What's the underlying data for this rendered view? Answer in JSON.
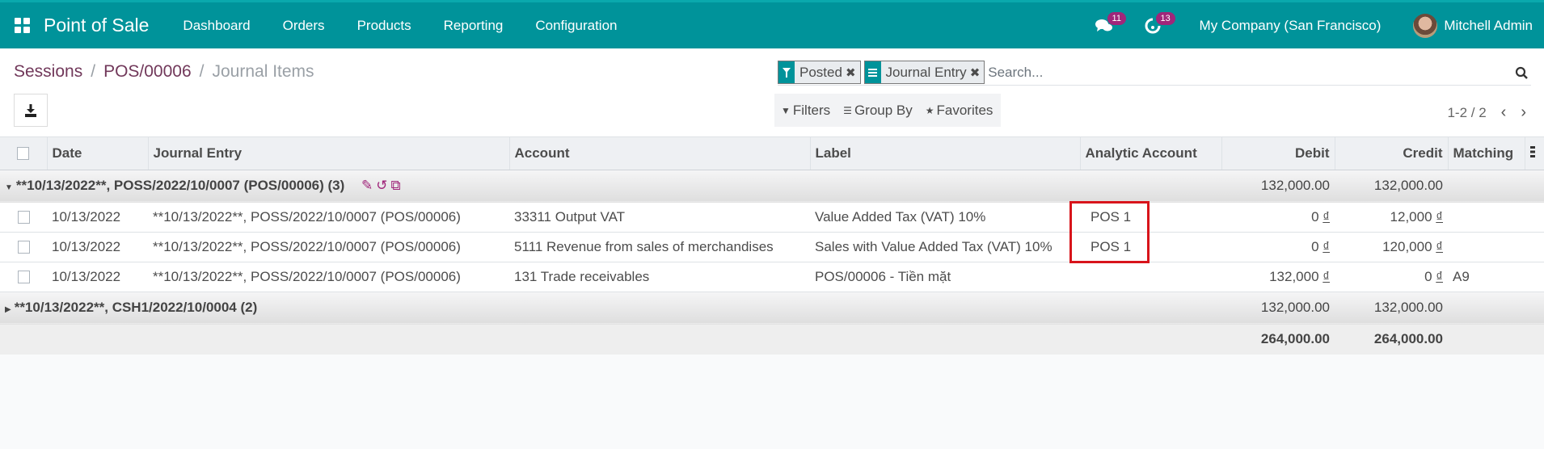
{
  "navbar": {
    "app_name": "Point of Sale",
    "menu": [
      "Dashboard",
      "Orders",
      "Products",
      "Reporting",
      "Configuration"
    ],
    "messages_count": "11",
    "activities_count": "13",
    "company": "My Company (San Francisco)",
    "user": "Mitchell Admin"
  },
  "breadcrumb": {
    "items": [
      "Sessions",
      "POS/00006"
    ],
    "current": "Journal Items",
    "separator": "/"
  },
  "search": {
    "facets": [
      {
        "icon": "filter-icon",
        "label": "Posted"
      },
      {
        "icon": "group-by-icon",
        "label": "Journal Entry"
      }
    ],
    "placeholder": "Search..."
  },
  "search_options": {
    "filters": "Filters",
    "group_by": "Group By",
    "favorites": "Favorites"
  },
  "pager": {
    "value": "1-2 / 2"
  },
  "table": {
    "columns": [
      "Date",
      "Journal Entry",
      "Account",
      "Label",
      "Analytic Account",
      "Debit",
      "Credit",
      "Matching"
    ],
    "groups": [
      {
        "title": "**10/13/2022**, POSS/2022/10/0007 (POS/00006) (3)",
        "expanded": true,
        "debit": "132,000.00",
        "credit": "132,000.00",
        "rows": [
          {
            "date": "10/13/2022",
            "entry": "**10/13/2022**, POSS/2022/10/0007 (POS/00006)",
            "account": "33311 Output VAT",
            "label": "Value Added Tax (VAT) 10%",
            "analytic": "POS 1",
            "debit": "0",
            "credit": "12,000",
            "matching": ""
          },
          {
            "date": "10/13/2022",
            "entry": "**10/13/2022**, POSS/2022/10/0007 (POS/00006)",
            "account": "5111 Revenue from sales of merchandises",
            "label": "Sales with Value Added Tax (VAT) 10%",
            "analytic": "POS 1",
            "debit": "0",
            "credit": "120,000",
            "matching": ""
          },
          {
            "date": "10/13/2022",
            "entry": "**10/13/2022**, POSS/2022/10/0007 (POS/00006)",
            "account": "131 Trade receivables",
            "label": "POS/00006 - Tiền mặt",
            "analytic": "",
            "debit": "132,000",
            "credit": "0",
            "matching": "A9"
          }
        ]
      },
      {
        "title": "**10/13/2022**, CSH1/2022/10/0004 (2)",
        "expanded": false,
        "debit": "132,000.00",
        "credit": "132,000.00"
      }
    ],
    "currency_symbol": "₫",
    "totals": {
      "debit": "264,000.00",
      "credit": "264,000.00"
    }
  },
  "colors": {
    "brand": "#00939a",
    "accent": "#71385a",
    "badge": "#a0267a",
    "highlight": "#d8141b"
  }
}
